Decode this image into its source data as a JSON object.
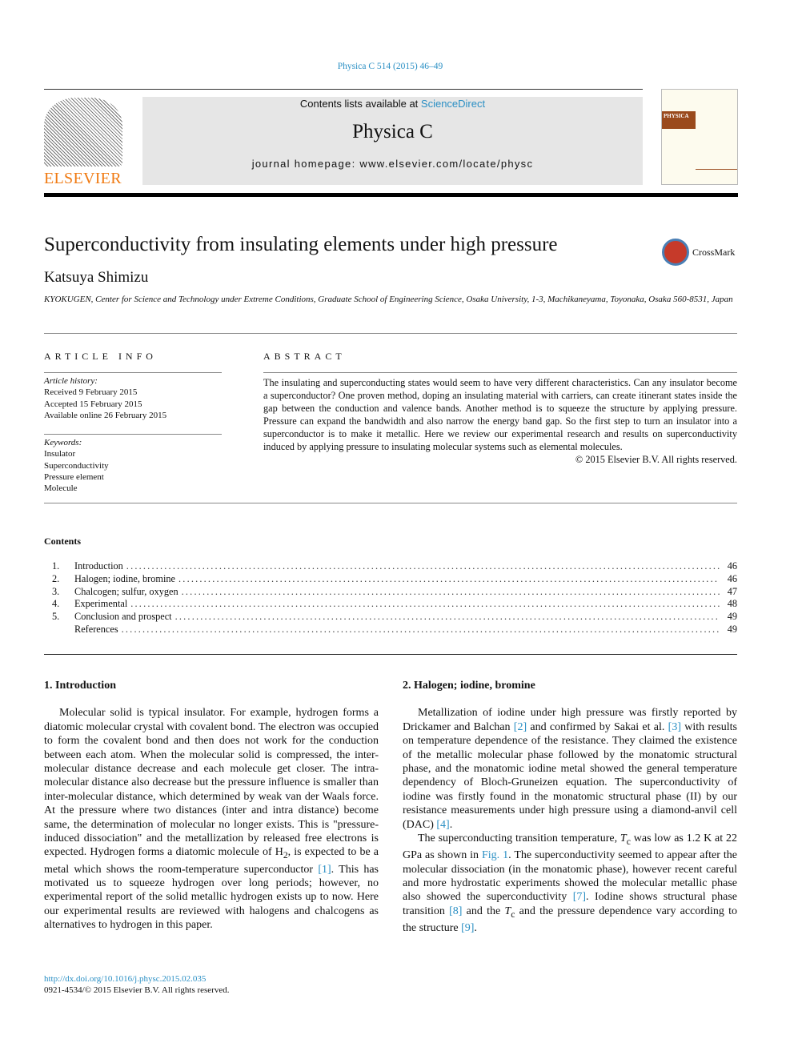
{
  "header": {
    "journal_ref": "Physica C 514 (2015) 46–49",
    "contents_prefix": "Contents lists available at ",
    "sciencedirect": "ScienceDirect",
    "journal_title": "Physica C",
    "homepage": "journal homepage: www.elsevier.com/locate/physc",
    "publisher_logo": "ELSEVIER",
    "cover_label": "PHYSICA",
    "crossmark": "CrossMark"
  },
  "article": {
    "title": "Superconductivity from insulating elements under high pressure",
    "author": "Katsuya Shimizu",
    "affiliation": "KYOKUGEN, Center for Science and Technology under Extreme Conditions, Graduate School of Engineering Science, Osaka University, 1-3, Machikaneyama, Toyonaka, Osaka 560-8531, Japan"
  },
  "info": {
    "heading": "ARTICLE INFO",
    "history_label": "Article history:",
    "history": [
      "Received 9 February 2015",
      "Accepted 15 February 2015",
      "Available online 26 February 2015"
    ],
    "keywords_label": "Keywords:",
    "keywords": [
      "Insulator",
      "Superconductivity",
      "Pressure element",
      "Molecule"
    ]
  },
  "abstract": {
    "heading": "ABSTRACT",
    "text": "The insulating and superconducting states would seem to have very different characteristics. Can any insulator become a superconductor? One proven method, doping an insulating material with carriers, can create itinerant states inside the gap between the conduction and valence bands. Another method is to squeeze the structure by applying pressure. Pressure can expand the bandwidth and also narrow the energy band gap. So the first step to turn an insulator into a superconductor is to make it metallic. Here we review our experimental research and results on superconductivity induced by applying pressure to insulating molecular systems such as elemental molecules.",
    "copyright": "© 2015 Elsevier B.V. All rights reserved."
  },
  "contents": {
    "heading": "Contents",
    "items": [
      {
        "num": "1.",
        "title": "Introduction",
        "page": "46"
      },
      {
        "num": "2.",
        "title": "Halogen; iodine, bromine",
        "page": "46"
      },
      {
        "num": "3.",
        "title": "Chalcogen; sulfur, oxygen",
        "page": "47"
      },
      {
        "num": "4.",
        "title": "Experimental",
        "page": "48"
      },
      {
        "num": "5.",
        "title": "Conclusion and prospect",
        "page": "49"
      },
      {
        "num": "",
        "title": "References",
        "page": "49"
      }
    ]
  },
  "sections": {
    "intro": {
      "heading": "1. Introduction",
      "p1": "Molecular solid is typical insulator. For example, hydrogen forms a diatomic molecular crystal with covalent bond. The electron was occupied to form the covalent bond and then does not work for the conduction between each atom. When the molecular solid is compressed, the inter-molecular distance decrease and each molecule get closer. The intra-molecular distance also decrease but the pressure influence is smaller than inter-molecular distance, which determined by weak van der Waals force. At the pressure where two distances (inter and intra distance) become same, the determination of molecular no longer exists. This is \"pressure-induced dissociation\" and the metallization by released free electrons is expected. Hydrogen forms a diatomic molecule of H",
      "sub": "2",
      "p1b": ", is expected to be a metal which shows the room-temperature superconductor ",
      "ref1": "[1]",
      "p1c": ". This has motivated us to squeeze hydrogen over long periods; however, no experimental report of the solid metallic hydrogen exists up to now. Here our experimental results are reviewed with halogens and chalcogens as alternatives to hydrogen in this paper."
    },
    "halogen": {
      "heading": "2. Halogen; iodine, bromine",
      "a": "Metallization of iodine under high pressure was firstly reported by Drickamer and Balchan ",
      "r2": "[2]",
      "b": " and confirmed by Sakai et al. ",
      "r3": "[3]",
      "c": " with results on temperature dependence of the resistance. They claimed the existence of the metallic molecular phase followed by the monatomic structural phase, and the monatomic iodine metal showed the general temperature dependency of Bloch-Gruneizen equation. The superconductivity of iodine was firstly found in the monatomic structural phase (II) by our resistance measurements under high pressure using a diamond-anvil cell (DAC) ",
      "r4": "[4]",
      "d": ".",
      "e": "The superconducting transition temperature, ",
      "tc": "T",
      "tcsub": "c",
      "f": " was low as 1.2 K at 22 GPa as shown in ",
      "fig": "Fig. 1",
      "g": ". The superconductivity seemed to appear after the molecular dissociation (in the monatomic phase), however recent careful and more hydrostatic experiments showed the molecular metallic phase also showed the superconductivity ",
      "r7": "[7]",
      "h": ". Iodine shows structural phase transition ",
      "r8": "[8]",
      "i": " and the ",
      "j": " and the pressure dependence vary according to the structure ",
      "r9": "[9]",
      "k": "."
    }
  },
  "footer": {
    "doi": "http://dx.doi.org/10.1016/j.physc.2015.02.035",
    "issn": "0921-4534/© 2015 Elsevier B.V. All rights reserved."
  },
  "colors": {
    "link": "#2a8fc4",
    "elsevier_orange": "#f07a12"
  }
}
